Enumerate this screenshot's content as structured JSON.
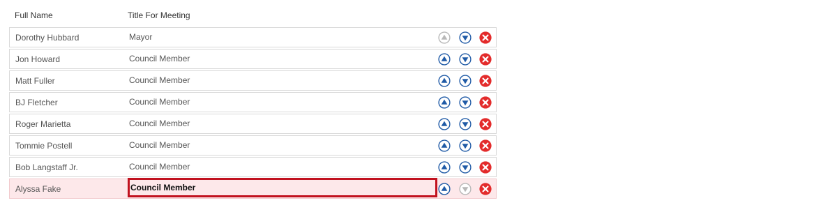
{
  "headers": {
    "full_name": "Full Name",
    "title_for_meeting": "Title For Meeting"
  },
  "rows": [
    {
      "name": "Dorothy Hubbard",
      "title": "Mayor",
      "up_enabled": false,
      "down_enabled": true,
      "editing": false
    },
    {
      "name": "Jon Howard",
      "title": "Council Member",
      "up_enabled": true,
      "down_enabled": true,
      "editing": false
    },
    {
      "name": "Matt Fuller",
      "title": "Council Member",
      "up_enabled": true,
      "down_enabled": true,
      "editing": false
    },
    {
      "name": "BJ Fletcher",
      "title": "Council Member",
      "up_enabled": true,
      "down_enabled": true,
      "editing": false
    },
    {
      "name": "Roger Marietta",
      "title": "Council Member",
      "up_enabled": true,
      "down_enabled": true,
      "editing": false
    },
    {
      "name": "Tommie Postell",
      "title": "Council Member",
      "up_enabled": true,
      "down_enabled": true,
      "editing": false
    },
    {
      "name": "Bob Langstaff Jr.",
      "title": "Council Member",
      "up_enabled": true,
      "down_enabled": true,
      "editing": false
    },
    {
      "name": "Alyssa Fake",
      "title": "Council Member",
      "up_enabled": true,
      "down_enabled": false,
      "editing": true
    }
  ],
  "icons": {
    "move_up": "arrow-up-circle-icon",
    "move_down": "arrow-down-circle-icon",
    "remove": "close-circle-icon"
  },
  "colors": {
    "arrow_active": "#1f5aa6",
    "arrow_disabled": "#b8b8b8",
    "remove": "#e32b2b",
    "editing_row_bg": "#fde8ea",
    "editing_border": "#c1121f"
  }
}
